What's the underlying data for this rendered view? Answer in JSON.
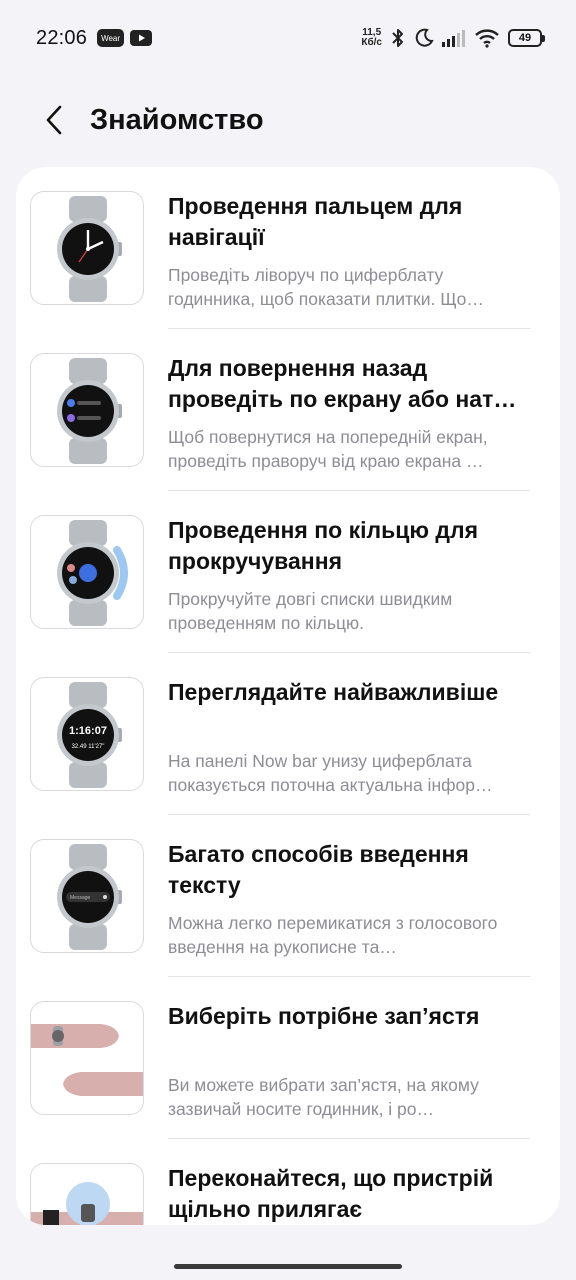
{
  "status_bar": {
    "time": "22:06",
    "app_badge": "Wear",
    "net_speed_value": "11,5",
    "net_speed_unit": "Кб/с",
    "battery": "49"
  },
  "header": {
    "title": "Знайомство",
    "back_icon": "chevron-left-icon"
  },
  "items": [
    {
      "title": "Проведення пальцем для навігації",
      "desc": "Проведіть ліворуч по циферблату годинника, щоб показати плитки. Що…"
    },
    {
      "title": "Для повернення назад проведіть по екрану або нат…",
      "desc": "Щоб повернутися на попередній екран, проведіть праворуч від краю екрана …"
    },
    {
      "title": "Проведення по кільцю для прокручування",
      "desc": "Прокручуйте довгі списки швидким проведенням по кільцю."
    },
    {
      "title": "Переглядайте найважливіше",
      "desc": "На панелі Now bar унизу циферблата показується поточна актуальна інфор…",
      "watch_time": "1:16:07",
      "watch_sub": "32.49 11'27\""
    },
    {
      "title": "Багато способів введення тексту",
      "desc": "Можна легко перемикатися з голосового введення на рукописне та…",
      "watch_input": "Message"
    },
    {
      "title": "Виберіть потрібне зап’ястя",
      "desc": "Ви можете вибрати зап’ястя, на якому зазвичай носите годинник, і ро…"
    },
    {
      "title": "Переконайтеся, що пристрій щільно прилягає",
      "desc": ""
    }
  ],
  "colors": {
    "background": "#f4f4f8",
    "card": "#ffffff",
    "desc_text": "#8d8d93",
    "watch_band": "#b9bdc2"
  }
}
